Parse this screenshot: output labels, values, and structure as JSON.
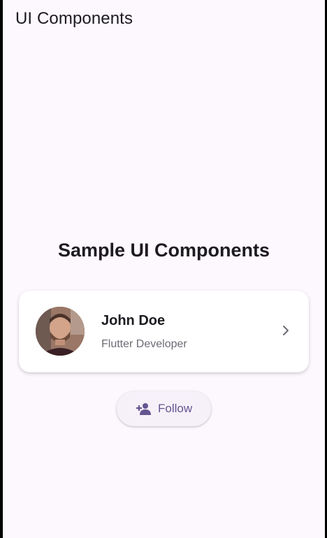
{
  "app_bar": {
    "title": "UI Components"
  },
  "main": {
    "heading": "Sample UI Components",
    "profile_card": {
      "name": "John Doe",
      "subtitle": "Flutter Developer",
      "avatar_icon": "person-photo",
      "trailing_icon": "chevron-right-icon"
    },
    "follow_button": {
      "label": "Follow",
      "icon": "person-add-icon"
    }
  },
  "colors": {
    "background": "#fdf7fe",
    "primary": "#65558f",
    "text": "#1d1b20",
    "secondary_text": "#6e6a72"
  }
}
